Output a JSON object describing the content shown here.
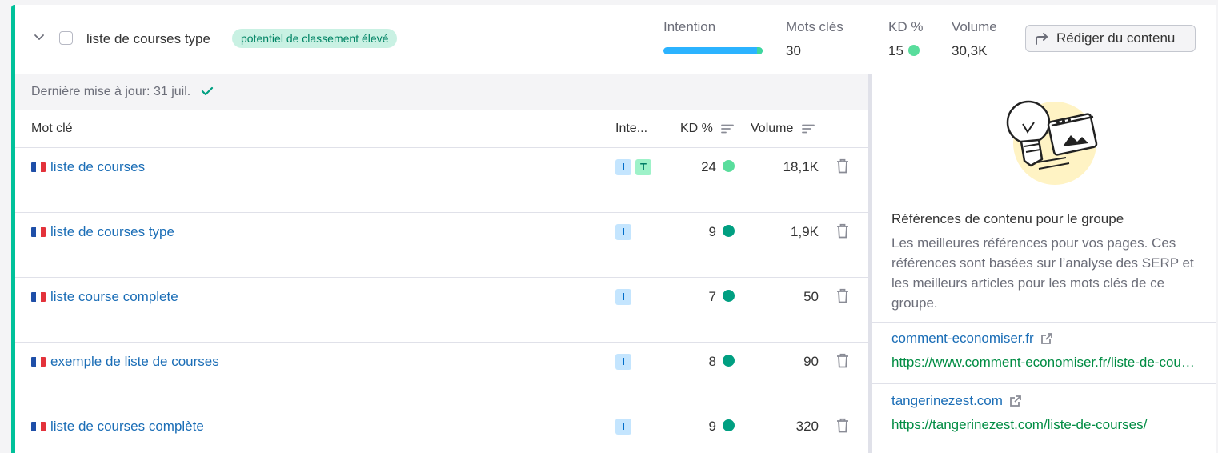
{
  "group": {
    "title": "liste de courses type",
    "badge": "potentiel de classement élevé",
    "metrics": {
      "intention_label": "Intention",
      "keywords_label": "Mots clés",
      "keywords_value": "30",
      "kd_label": "KD %",
      "kd_value": "15",
      "volume_label": "Volume",
      "volume_value": "30,3K"
    },
    "write_button": "Rédiger du contenu"
  },
  "table": {
    "updated": "Dernière mise à jour: 31 juil.",
    "columns": {
      "keyword": "Mot clé",
      "intent": "Inte...",
      "kd": "KD %",
      "volume": "Volume"
    },
    "rows": [
      {
        "keyword": "liste de courses",
        "intents": [
          "I",
          "T"
        ],
        "kd": "24",
        "kd_color": "#59dd9c",
        "volume": "18,1K"
      },
      {
        "keyword": "liste de courses type",
        "intents": [
          "I"
        ],
        "kd": "9",
        "kd_color": "#009f81",
        "volume": "1,9K"
      },
      {
        "keyword": "liste course complete",
        "intents": [
          "I"
        ],
        "kd": "7",
        "kd_color": "#009f81",
        "volume": "50"
      },
      {
        "keyword": "exemple de liste de courses",
        "intents": [
          "I"
        ],
        "kd": "8",
        "kd_color": "#009f81",
        "volume": "90"
      },
      {
        "keyword": "liste de courses complète",
        "intents": [
          "I"
        ],
        "kd": "9",
        "kd_color": "#009f81",
        "volume": "320"
      }
    ]
  },
  "references": {
    "title": "Références de contenu pour le groupe",
    "description": "Les meilleures références pour vos pages. Ces références sont basées sur l’analyse des SERP et les meilleurs articles pour les mots clés de ce groupe.",
    "items": [
      {
        "domain": "comment-economiser.fr",
        "url": "https://www.comment-economiser.fr/liste-de-courses.html"
      },
      {
        "domain": "tangerinezest.com",
        "url": "https://tangerinezest.com/liste-de-courses/"
      }
    ]
  },
  "colors": {
    "accent_green": "#00c19a",
    "link_blue": "#1a6db6",
    "url_green": "#008c43",
    "intent_blue": "#2bb3ff"
  }
}
